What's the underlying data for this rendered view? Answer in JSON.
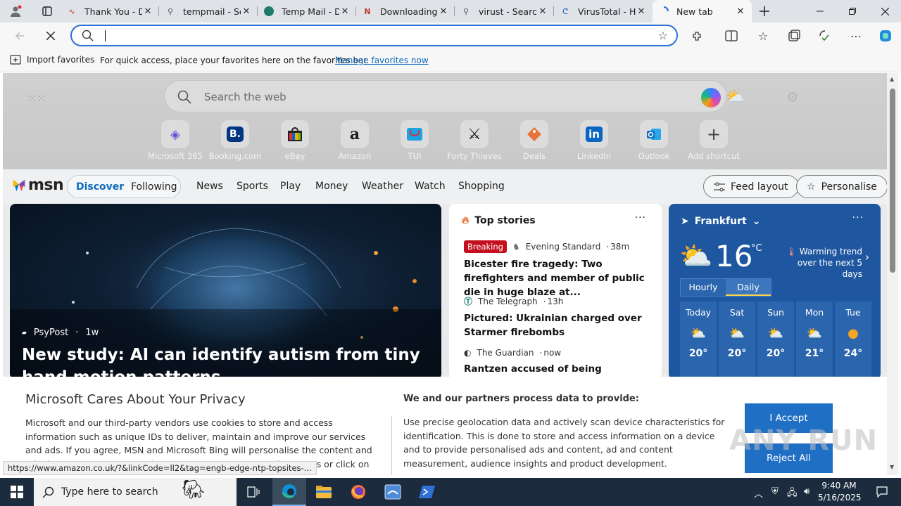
{
  "tabs": [
    {
      "title": "Thank You - D",
      "icon": "pdf-icon"
    },
    {
      "title": "tempmail - Se",
      "icon": "search-icon"
    },
    {
      "title": "Temp Mail - D",
      "icon": "tempmail-icon"
    },
    {
      "title": "Downloading",
      "icon": "download-icon"
    },
    {
      "title": "virust - Search",
      "icon": "search-icon"
    },
    {
      "title": "VirusTotal - H",
      "icon": "virustotal-icon"
    },
    {
      "title": "New tab",
      "icon": "loading-icon",
      "active": true
    }
  ],
  "toolbar": {
    "address_value": "",
    "address_placeholder": ""
  },
  "favbar": {
    "import_label": "Import favorites",
    "message": "For quick access, place your favorites here on the favorites bar.",
    "manage_link": "Manage favorites now"
  },
  "newtab": {
    "search_placeholder": "Search the web",
    "shortcuts": [
      {
        "label": "Microsoft 365",
        "icon": "m365-icon",
        "glyph": "◆",
        "color": "#6b4fd6"
      },
      {
        "label": "Booking.com",
        "icon": "booking-icon",
        "glyph": "B.",
        "color": "#003580"
      },
      {
        "label": "eBay",
        "icon": "ebay-icon",
        "glyph": "▦",
        "color": "#e53238"
      },
      {
        "label": "Amazon",
        "icon": "amazon-icon",
        "glyph": "a",
        "color": "#111111"
      },
      {
        "label": "TUI",
        "icon": "tui-icon",
        "glyph": "◡",
        "color": "#1ea3e0"
      },
      {
        "label": "Forty Thieves",
        "icon": "swords-icon",
        "glyph": "✕",
        "color": "#111111"
      },
      {
        "label": "Deals",
        "icon": "deals-icon",
        "glyph": "◆",
        "color": "#e8743b"
      },
      {
        "label": "LinkedIn",
        "icon": "linkedin-icon",
        "glyph": "in",
        "color": "#0a66c2"
      },
      {
        "label": "Outlook",
        "icon": "outlook-icon",
        "glyph": "✉",
        "color": "#0f6cbd"
      },
      {
        "label": "Add shortcut",
        "icon": "plus-icon",
        "glyph": "+",
        "color": "#444444"
      }
    ]
  },
  "msn": {
    "logo": "msn",
    "tabs": [
      "Discover",
      "Following"
    ],
    "nav": [
      "News",
      "Sports",
      "Play",
      "Money",
      "Weather",
      "Watch",
      "Shopping"
    ],
    "feed_layout": "Feed layout",
    "personalise": "Personalise"
  },
  "main_story": {
    "source": "PsyPost",
    "age": "1w",
    "headline": "New study: AI can identify autism from tiny hand motion patterns"
  },
  "top_stories": {
    "title": "Top stories",
    "items": [
      {
        "badge": "Breaking",
        "source": "Evening Standard",
        "age": "38m",
        "title": "Bicester fire tragedy: Two firefighters and member of public die in huge blaze at..."
      },
      {
        "badge": "",
        "source": "The Telegraph",
        "age": "13h",
        "title": "Pictured: Ukrainian charged over Starmer firebombs"
      },
      {
        "badge": "",
        "source": "The Guardian",
        "age": "now",
        "title": "Rantzen accused of being ‘disrespectful’"
      }
    ]
  },
  "weather": {
    "location": "Frankfurt",
    "temp": "16",
    "unit": "°C",
    "trend": "Warming trend over the next 5 days",
    "modes": [
      "Hourly",
      "Daily"
    ],
    "selected_mode": "Daily",
    "days": [
      {
        "name": "Today",
        "icon": "partly-cloudy-icon",
        "high": "20°"
      },
      {
        "name": "Sat",
        "icon": "partly-cloudy-icon",
        "high": "20°"
      },
      {
        "name": "Sun",
        "icon": "partly-cloudy-icon",
        "high": "20°"
      },
      {
        "name": "Mon",
        "icon": "partly-cloudy-icon",
        "high": "21°"
      },
      {
        "name": "Tue",
        "icon": "sunny-icon",
        "high": "24°"
      }
    ]
  },
  "privacy": {
    "title": "Microsoft Cares About Your Privacy",
    "body": "Microsoft and our third-party vendors use cookies to store and access information such as unique IDs to deliver, maintain and improve our services and ads. If you agree, MSN and Microsoft Bing will personalise the content and ads that you see. You can select 'I Accept' to consent to these uses or click on 'Manage preferences' to",
    "subtitle": "We and our partners process data to provide:",
    "detail": "Use precise geolocation data and actively scan device characteristics for identification. This is done to store and access information on a device and to provide personalised ads and content, ad and content measurement, audience insights and product development.",
    "accept": "I Accept",
    "reject": "Reject All"
  },
  "watermark": "ANY RUN",
  "status_url": "https://www.amazon.co.uk/?&linkCode=ll2&tag=engb-edge-ntp-topsites-...",
  "taskbar": {
    "search_placeholder": "Type here to search",
    "time": "9:40 AM",
    "date": "5/16/2025"
  }
}
